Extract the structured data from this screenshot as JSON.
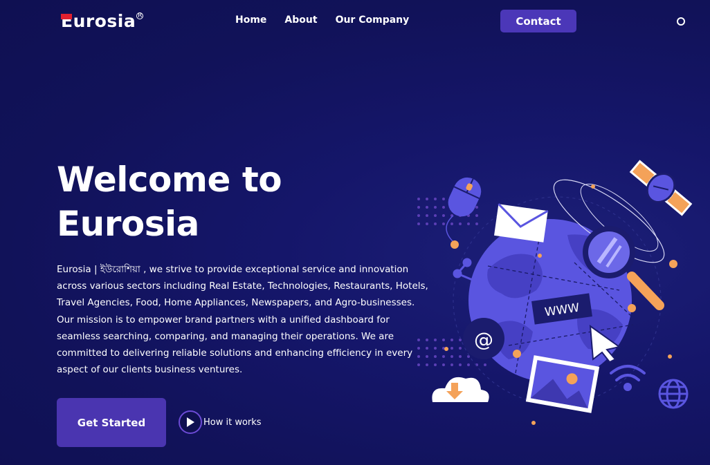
{
  "header": {
    "logo_text": "Eurosia",
    "logo_registered": "R",
    "nav": [
      {
        "label": "Home"
      },
      {
        "label": "About"
      },
      {
        "label": "Our Company"
      }
    ],
    "contact_label": "Contact",
    "search_icon": "circle-icon"
  },
  "hero": {
    "title_line1": "Welcome to",
    "title_line2": "Eurosia",
    "description": "Eurosia | ইউরোশিয়া , we strive to provide exceptional service and innovation across various sectors including Real Estate, Technologies, Restaurants, Hotels, Travel Agencies, Food, Home Appliances, Newspapers, and Agro-businesses. Our mission is to empower brand partners with a unified dashboard for seamless searching, comparing, and managing their operations. We are committed to delivering reliable solutions and enhancing efficiency in every aspect of our clients business ventures.",
    "cta_label": "Get Started",
    "how_label": "How it works"
  },
  "illustration": {
    "www_label": "WWW",
    "at_symbol": "@"
  },
  "colors": {
    "background": "#12135a",
    "accent": "#4b37b8",
    "globe": "#5a55e0",
    "orange": "#f4a259",
    "logo_red": "#e2202f"
  }
}
